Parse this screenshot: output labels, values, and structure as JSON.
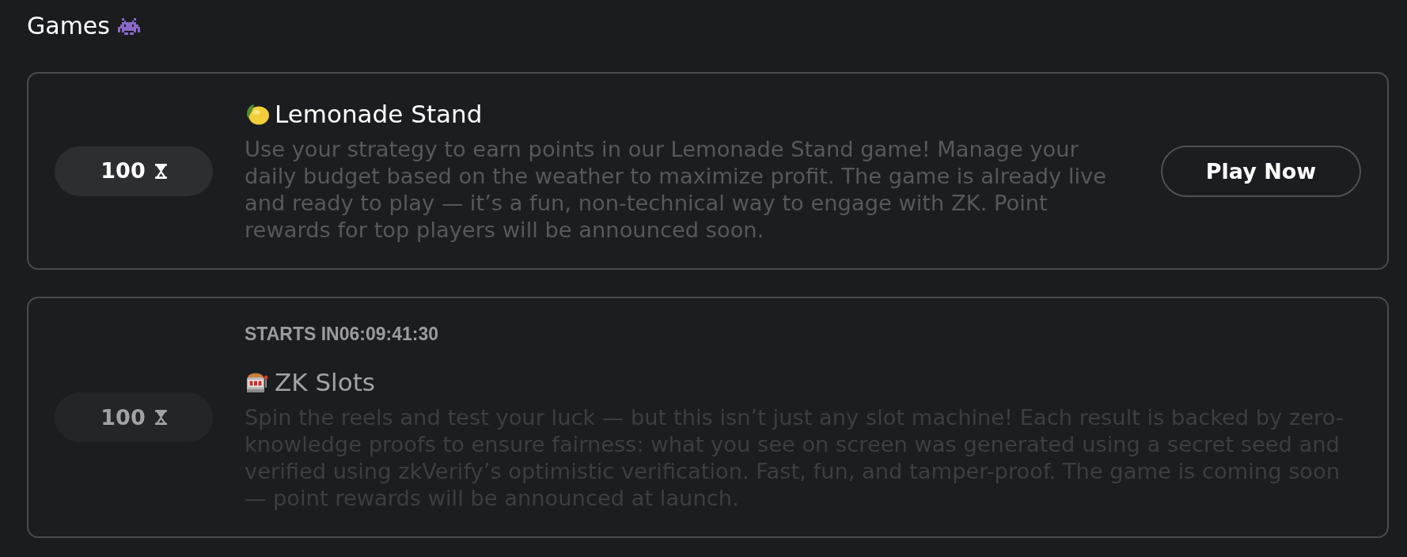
{
  "page": {
    "title": "Games"
  },
  "games": [
    {
      "points": "100",
      "title": "Lemonade Stand",
      "description": "Use your strategy to earn points in our Lemonade Stand game! Manage your daily budget based on the weather to maximize profit. The game is already live and ready to play — it’s a fun, non-technical way to engage with ZK. Point rewards for top players will be announced soon.",
      "disabled": false,
      "button": "Play Now"
    },
    {
      "points": "100",
      "starts_in": "STARTS IN06:09:41:30",
      "title": "ZK Slots",
      "description": "Spin the reels and test your luck — but this isn’t just any slot machine! Each result is backed by zero-knowledge proofs to ensure fairness: what you see on screen was generated using a secret seed and verified using zkVerify’s optimistic verification. Fast, fun, and tamper-proof. The game is coming soon — point rewards will be announced at launch.",
      "disabled": true
    }
  ]
}
